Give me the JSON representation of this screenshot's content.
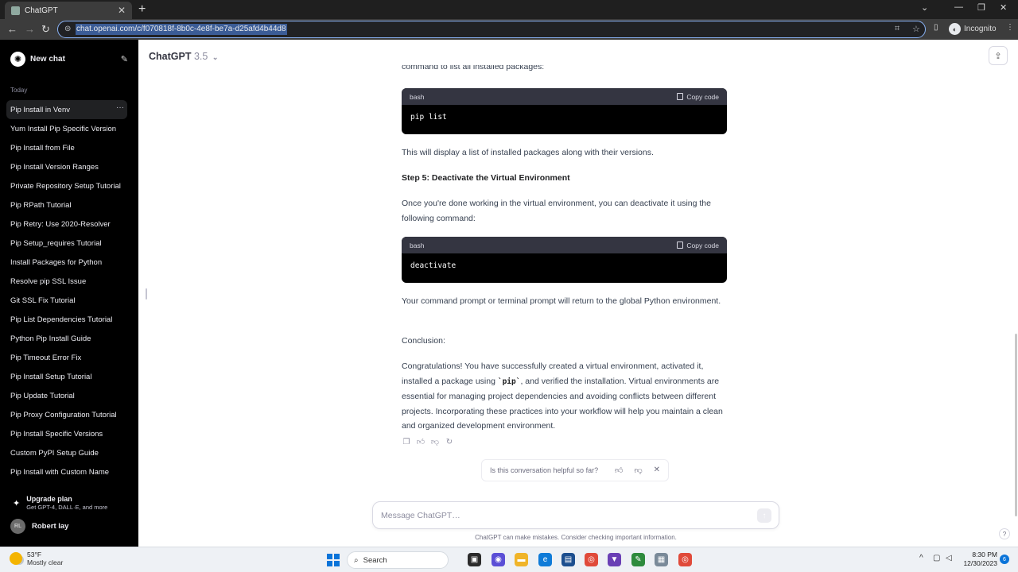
{
  "browser": {
    "tab_title": "ChatGPT",
    "tab_close": "✕",
    "new_tab": "+",
    "url": "chat.openai.com/c/f070818f-8b0c-4e8f-be7a-d25afd4b44d8",
    "profile_label": "Incognito",
    "window_controls": [
      "⌄",
      "—",
      "❐",
      "✕"
    ]
  },
  "sidebar": {
    "new_chat_label": "New chat",
    "today_label": "Today",
    "history": [
      "Pip Install in Venv",
      "Yum Install Pip Specific Version",
      "Pip Install from File",
      "Pip Install Version Ranges",
      "Private Repository Setup Tutorial",
      "Pip RPath Tutorial",
      "Pip Retry: Use 2020-Resolver",
      "Pip Setup_requires Tutorial",
      "Install Packages for Python",
      "Resolve pip SSL Issue",
      "Git SSL Fix Tutorial",
      "Pip List Dependencies Tutorial",
      "Python Pip Install Guide",
      "Pip Timeout Error Fix",
      "Pip Install Setup Tutorial",
      "Pip Update Tutorial",
      "Pip Proxy Configuration Tutorial",
      "Pip Install Specific Versions",
      "Custom PyPI Setup Guide",
      "Pip Install with Custom Name"
    ],
    "active_item_menu": "···",
    "upgrade_title": "Upgrade plan",
    "upgrade_subtitle": "Get GPT-4, DALL·E, and more",
    "user_initials": "RL",
    "user_name": "Robert lay"
  },
  "header": {
    "model_name": "ChatGPT",
    "model_version": "3.5",
    "model_chevron": "⌄"
  },
  "conversation": {
    "clipped_line": "command to list all installed packages:",
    "code1_lang": "bash",
    "code1_copy": "Copy code",
    "code1_body": "pip list",
    "para1": "This will display a list of installed packages along with their versions.",
    "step5": "Step 5: Deactivate the Virtual Environment",
    "para2": "Once you're done working in the virtual environment, you can deactivate it using the following command:",
    "code2_lang": "bash",
    "code2_copy": "Copy code",
    "code2_body": "deactivate",
    "para3": "Your command prompt or terminal prompt will return to the global Python environment.",
    "conclusion_heading": "Conclusion:",
    "para4_a": "Congratulations! You have successfully created a virtual environment, activated it, installed a package using ",
    "para4_code": "`pip`",
    "para4_b": ", and verified the installation. Virtual environments are essential for managing project dependencies and avoiding conflicts between different projects. Incorporating these practices into your workflow will help you maintain a clean and organized development environment."
  },
  "feedback": {
    "question": "Is this conversation helpful so far?"
  },
  "composer": {
    "placeholder": "Message ChatGPT…",
    "disclaimer": "ChatGPT can make mistakes. Consider checking important information.",
    "help": "?"
  },
  "taskbar": {
    "temperature": "53°F",
    "weather_desc": "Mostly clear",
    "search_label": "Search",
    "time": "8:30 PM",
    "date": "12/30/2023",
    "notification_count": "6"
  },
  "colors": {
    "sidebar_bg": "#000000",
    "code_header": "#343541",
    "accent_blue": "#0a74d9"
  }
}
